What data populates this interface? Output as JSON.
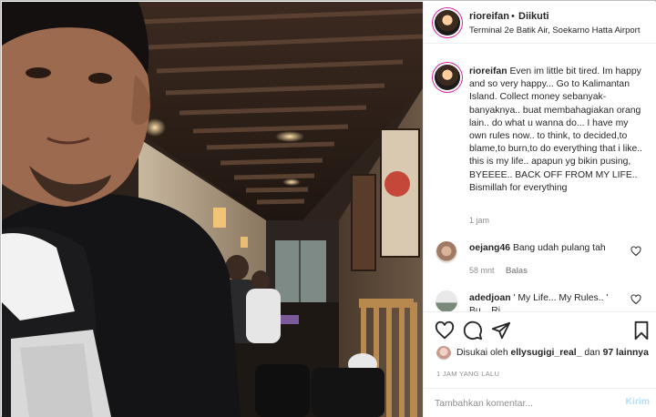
{
  "post": {
    "username": "rioreifan",
    "dot": "•",
    "follow_status": "Diikuti",
    "location": "Terminal 2e Batik Air, Soekarno Hatta Airport"
  },
  "caption": {
    "username": "rioreifan",
    "text": "Even im little bit tired. Im happy and so very happy... Go to Kalimantan Island. Collect money sebanyak-banyaknya.. buat membahagiakan orang lain.. do what u wanna do... I have my own rules now.. to think, to decided,to blame,to burn,to do everything that i like.. this is my life.. apapun yg bikin pusing, BYEEEE.. BACK OFF FROM MY LIFE.. Bismillah for everything",
    "time": "1 jam"
  },
  "comments": [
    {
      "username": "oejang46",
      "text": "Bang udah pulang tah",
      "time": "58 mnt",
      "reply_label": "Balas"
    },
    {
      "username": "adedjoan",
      "text": "' My Life... My Rules.. ' Bu... Ri..."
    }
  ],
  "actions": {
    "icons": [
      "heart-icon",
      "comment-icon",
      "share-icon",
      "bookmark-icon"
    ],
    "liked_by_prefix": "Disukai oleh",
    "liked_by_user": "ellysugigi_real_",
    "liked_by_connector": "dan",
    "liked_by_others": "97 lainnya",
    "posted_time": "1 JAM YANG LALU"
  },
  "composer": {
    "placeholder": "Tambahkan komentar...",
    "send_label": "Kirim"
  },
  "colors": {
    "story_ring": "#d6249f",
    "send_disabled": "#b2dffc",
    "muted": "#8e8e8e"
  }
}
